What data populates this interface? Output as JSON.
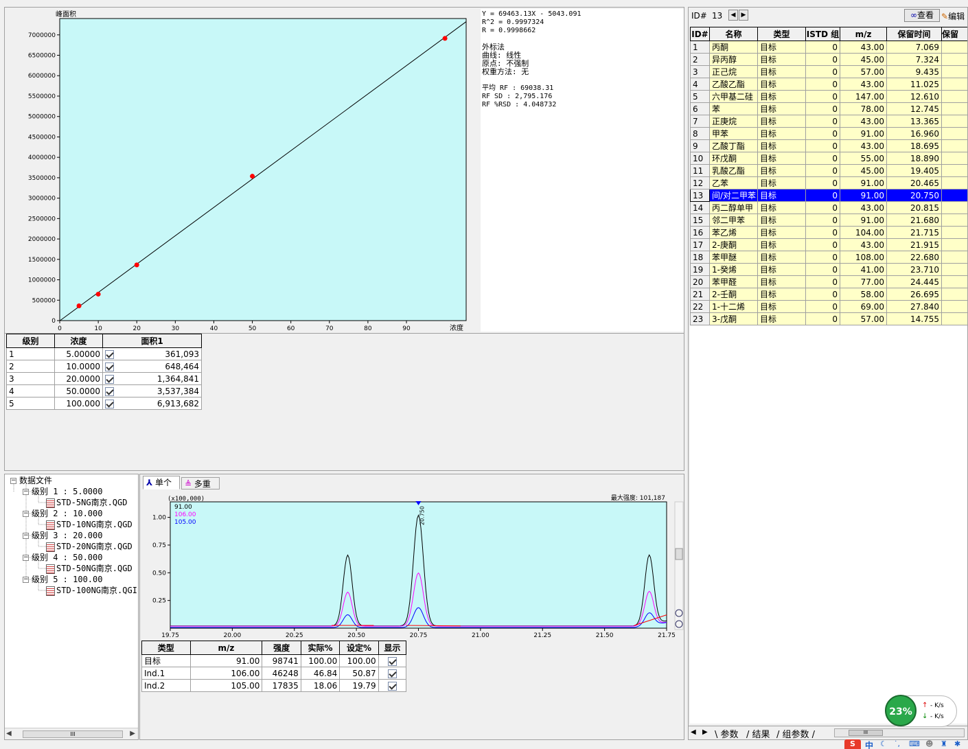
{
  "calibration": {
    "y_axis_label": "峰面积",
    "x_axis_label": "浓度",
    "y_ticks": [
      "0",
      "500000",
      "1000000",
      "1500000",
      "2000000",
      "2500000",
      "3000000",
      "3500000",
      "4000000",
      "4500000",
      "5000000",
      "5500000",
      "6000000",
      "6500000",
      "7000000"
    ],
    "x_ticks": [
      "0",
      "10",
      "20",
      "30",
      "40",
      "50",
      "60",
      "70",
      "80",
      "90"
    ],
    "points": [
      {
        "x": 5,
        "y": 361093
      },
      {
        "x": 10,
        "y": 648464
      },
      {
        "x": 20,
        "y": 1364841
      },
      {
        "x": 50,
        "y": 3537384
      },
      {
        "x": 100,
        "y": 6913682
      }
    ],
    "equation": "Y = 69463.13X - 5043.091",
    "r2": "R^2 = 0.9997324",
    "r": "R = 0.9998662",
    "method": "外标法",
    "curve": "曲线: 线性",
    "origin": "原点: 不强制",
    "weight": "权重方法: 无",
    "avg_rf": "平均 RF :  69038.31",
    "rf_sd": "RF SD : 2,795.176",
    "rf_rsd": "RF %RSD : 4.048732",
    "colors": {
      "plot_bg": "#c8f8f8",
      "point": "#ff0000",
      "line": "#000000"
    }
  },
  "levels_table": {
    "headers": [
      "级别",
      "浓度",
      "面积1"
    ],
    "rows": [
      {
        "level": "1",
        "conc": "5.00000",
        "area": "361,093"
      },
      {
        "level": "2",
        "conc": "10.0000",
        "area": "648,464"
      },
      {
        "level": "3",
        "conc": "20.0000",
        "area": "1,364,841"
      },
      {
        "level": "4",
        "conc": "50.0000",
        "area": "3,537,384"
      },
      {
        "level": "5",
        "conc": "100.000",
        "area": "6,913,682"
      }
    ]
  },
  "tree": {
    "root": "数据文件",
    "levels": [
      {
        "label": "级别 1 : 5.0000",
        "file": "STD-5NG南京.QGD"
      },
      {
        "label": "级别 2 : 10.000",
        "file": "STD-10NG南京.QGD"
      },
      {
        "label": "级别 3 : 20.000",
        "file": "STD-20NG南京.QGD"
      },
      {
        "label": "级别 4 : 50.000",
        "file": "STD-50NG南京.QGD"
      },
      {
        "label": "级别 5 : 100.00",
        "file": "STD-100NG南京.QGI"
      }
    ]
  },
  "chrom": {
    "tab_single": "单个",
    "tab_multi": "多重",
    "scale_label": "(x100,000)",
    "max_intensity": "最大强度: 101,187",
    "legend": [
      {
        "label": "91.00",
        "color": "#000000"
      },
      {
        "label": "106.00",
        "color": "#ff00ff"
      },
      {
        "label": "105.00",
        "color": "#0000ff"
      }
    ],
    "y_ticks": [
      "1.00",
      "0.75",
      "0.50",
      "0.25"
    ],
    "x_ticks": [
      "19.75",
      "20.00",
      "20.25",
      "20.50",
      "20.75",
      "21.00",
      "21.25",
      "21.50",
      "21.75"
    ],
    "peak_label": "20.750",
    "colors": {
      "plot_bg": "#c8f8f8"
    }
  },
  "ion_table": {
    "headers": [
      "类型",
      "m/z",
      "强度",
      "实际%",
      "设定%",
      "显示"
    ],
    "rows": [
      {
        "type": "目标",
        "mz": "91.00",
        "intensity": "98741",
        "actual": "100.00",
        "set": "100.00"
      },
      {
        "type": "Ind.1",
        "mz": "106.00",
        "intensity": "46248",
        "actual": "46.84",
        "set": "50.87"
      },
      {
        "type": "Ind.2",
        "mz": "105.00",
        "intensity": "17835",
        "actual": "18.06",
        "set": "19.79"
      }
    ]
  },
  "compound_panel": {
    "id_label": "ID#",
    "id_value": "13",
    "view_button": "查看",
    "edit_button": "编辑",
    "headers": [
      "ID#",
      "名称",
      "类型",
      "ISTD 组",
      "m/z",
      "保留时间",
      "保留"
    ],
    "rows": [
      {
        "id": "1",
        "name": "丙酮",
        "type": "目标",
        "istd": "0",
        "mz": "43.00",
        "rt": "7.069"
      },
      {
        "id": "2",
        "name": "异丙醇",
        "type": "目标",
        "istd": "0",
        "mz": "45.00",
        "rt": "7.324"
      },
      {
        "id": "3",
        "name": "正己烷",
        "type": "目标",
        "istd": "0",
        "mz": "57.00",
        "rt": "9.435"
      },
      {
        "id": "4",
        "name": "乙酸乙酯",
        "type": "目标",
        "istd": "0",
        "mz": "43.00",
        "rt": "11.025"
      },
      {
        "id": "5",
        "name": "六甲基二硅",
        "type": "目标",
        "istd": "0",
        "mz": "147.00",
        "rt": "12.610"
      },
      {
        "id": "6",
        "name": "苯",
        "type": "目标",
        "istd": "0",
        "mz": "78.00",
        "rt": "12.745"
      },
      {
        "id": "7",
        "name": "正庚烷",
        "type": "目标",
        "istd": "0",
        "mz": "43.00",
        "rt": "13.365"
      },
      {
        "id": "8",
        "name": "甲苯",
        "type": "目标",
        "istd": "0",
        "mz": "91.00",
        "rt": "16.960"
      },
      {
        "id": "9",
        "name": "乙酸丁酯",
        "type": "目标",
        "istd": "0",
        "mz": "43.00",
        "rt": "18.695"
      },
      {
        "id": "10",
        "name": "环戊酮",
        "type": "目标",
        "istd": "0",
        "mz": "55.00",
        "rt": "18.890"
      },
      {
        "id": "11",
        "name": "乳酸乙酯",
        "type": "目标",
        "istd": "0",
        "mz": "45.00",
        "rt": "19.405"
      },
      {
        "id": "12",
        "name": "乙苯",
        "type": "目标",
        "istd": "0",
        "mz": "91.00",
        "rt": "20.465"
      },
      {
        "id": "13",
        "name": "间/对二甲苯",
        "type": "目标",
        "istd": "0",
        "mz": "91.00",
        "rt": "20.750"
      },
      {
        "id": "14",
        "name": "丙二醇单甲",
        "type": "目标",
        "istd": "0",
        "mz": "43.00",
        "rt": "20.815"
      },
      {
        "id": "15",
        "name": "邻二甲苯",
        "type": "目标",
        "istd": "0",
        "mz": "91.00",
        "rt": "21.680"
      },
      {
        "id": "16",
        "name": "苯乙烯",
        "type": "目标",
        "istd": "0",
        "mz": "104.00",
        "rt": "21.715"
      },
      {
        "id": "17",
        "name": "2-庚酮",
        "type": "目标",
        "istd": "0",
        "mz": "43.00",
        "rt": "21.915"
      },
      {
        "id": "18",
        "name": "苯甲醚",
        "type": "目标",
        "istd": "0",
        "mz": "108.00",
        "rt": "22.680"
      },
      {
        "id": "19",
        "name": "1-癸烯",
        "type": "目标",
        "istd": "0",
        "mz": "41.00",
        "rt": "23.710"
      },
      {
        "id": "20",
        "name": "苯甲醛",
        "type": "目标",
        "istd": "0",
        "mz": "77.00",
        "rt": "24.445"
      },
      {
        "id": "21",
        "name": "2-壬酮",
        "type": "目标",
        "istd": "0",
        "mz": "58.00",
        "rt": "26.695"
      },
      {
        "id": "22",
        "name": "1-十二烯",
        "type": "目标",
        "istd": "0",
        "mz": "69.00",
        "rt": "27.840"
      },
      {
        "id": "23",
        "name": "3-戊酮",
        "type": "目标",
        "istd": "0",
        "mz": "57.00",
        "rt": "14.755"
      }
    ],
    "selected_id": "13",
    "bottom_tabs": [
      "参数",
      "结果",
      "组参数"
    ]
  },
  "network_widget": {
    "percent": "23%",
    "up": "- K/s",
    "down": "- K/s",
    "color": "#2aa84a"
  },
  "taskbar": {
    "ime": "中"
  }
}
